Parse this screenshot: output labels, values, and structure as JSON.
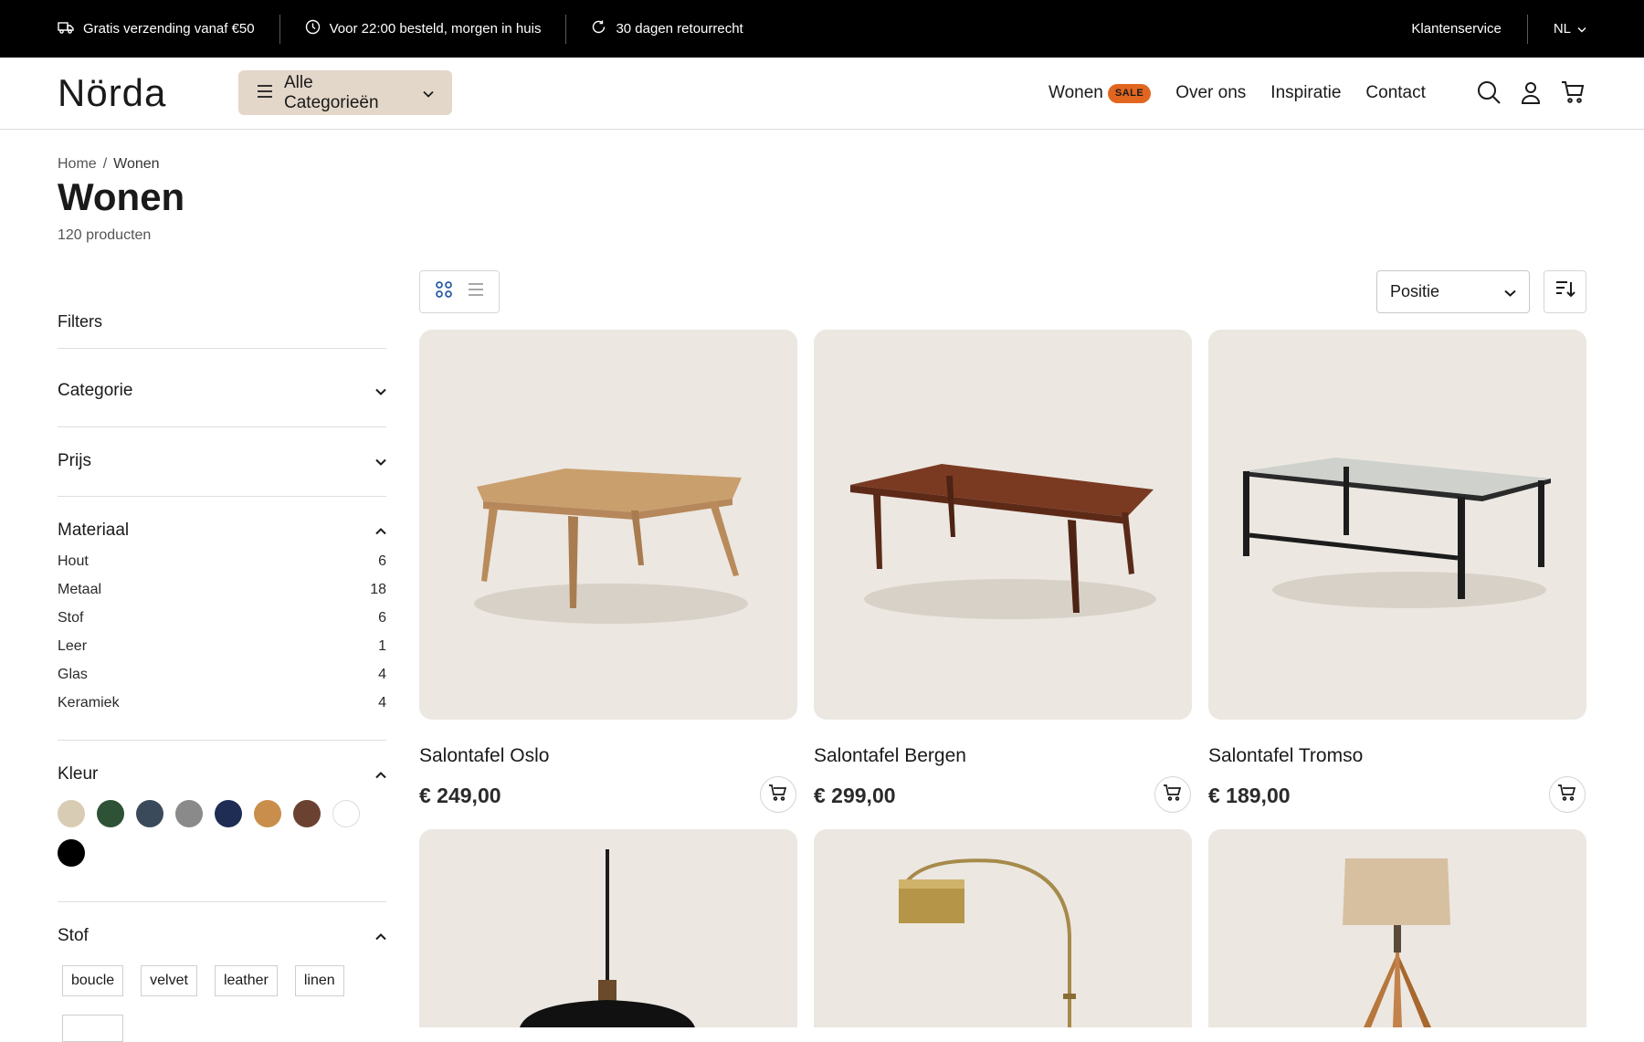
{
  "topbar": {
    "usps": [
      {
        "icon": "truck-icon",
        "text": "Gratis verzending vanaf €50"
      },
      {
        "icon": "clock-icon",
        "text": "Voor 22:00 besteld, morgen in huis"
      },
      {
        "icon": "return-icon",
        "text": "30 dagen retourrecht"
      }
    ],
    "service_link": "Klantenservice",
    "language": "NL"
  },
  "header": {
    "logo": "Nörda",
    "categories_button": "Alle Categorieën",
    "nav": [
      {
        "label": "Wonen",
        "badge": "SALE"
      },
      {
        "label": "Over ons"
      },
      {
        "label": "Inspiratie"
      },
      {
        "label": "Contact"
      }
    ],
    "icons": [
      "search-icon",
      "user-icon",
      "cart-icon"
    ]
  },
  "page": {
    "breadcrumb": [
      "Home",
      "Wonen"
    ],
    "breadcrumb_sep": "/",
    "title": "Wonen",
    "count": "120 producten"
  },
  "filters": {
    "title": "Filters",
    "facets": {
      "categorie": "Categorie",
      "prijs": "Prijs",
      "materiaal": "Materiaal",
      "kleur": "Kleur",
      "stof": "Stof"
    },
    "materials": [
      {
        "label": "Hout",
        "count": "6"
      },
      {
        "label": "Metaal",
        "count": "18"
      },
      {
        "label": "Stof",
        "count": "6"
      },
      {
        "label": "Leer",
        "count": "1"
      },
      {
        "label": "Glas",
        "count": "4"
      },
      {
        "label": "Keramiek",
        "count": "4"
      }
    ],
    "colors": [
      "#d9ccb4",
      "#2d5236",
      "#3a4a5a",
      "#8a8a8a",
      "#1f2d55",
      "#c98e4c",
      "#6b4232",
      "#ffffff",
      "#000000"
    ],
    "fabrics": [
      "boucle",
      "velvet",
      "leather",
      "linen"
    ]
  },
  "toolbar": {
    "sort_value": "Positie"
  },
  "products": [
    {
      "name": "Salontafel Oslo",
      "price": "€ 249,00"
    },
    {
      "name": "Salontafel Bergen",
      "price": "€ 299,00"
    },
    {
      "name": "Salontafel Tromso",
      "price": "€ 189,00"
    }
  ],
  "colors": {
    "topbar_bg": "#000000",
    "category_button_bg": "#e3d7c9",
    "sale_badge": "#e2661f",
    "card_bg": "#ece7e1"
  }
}
